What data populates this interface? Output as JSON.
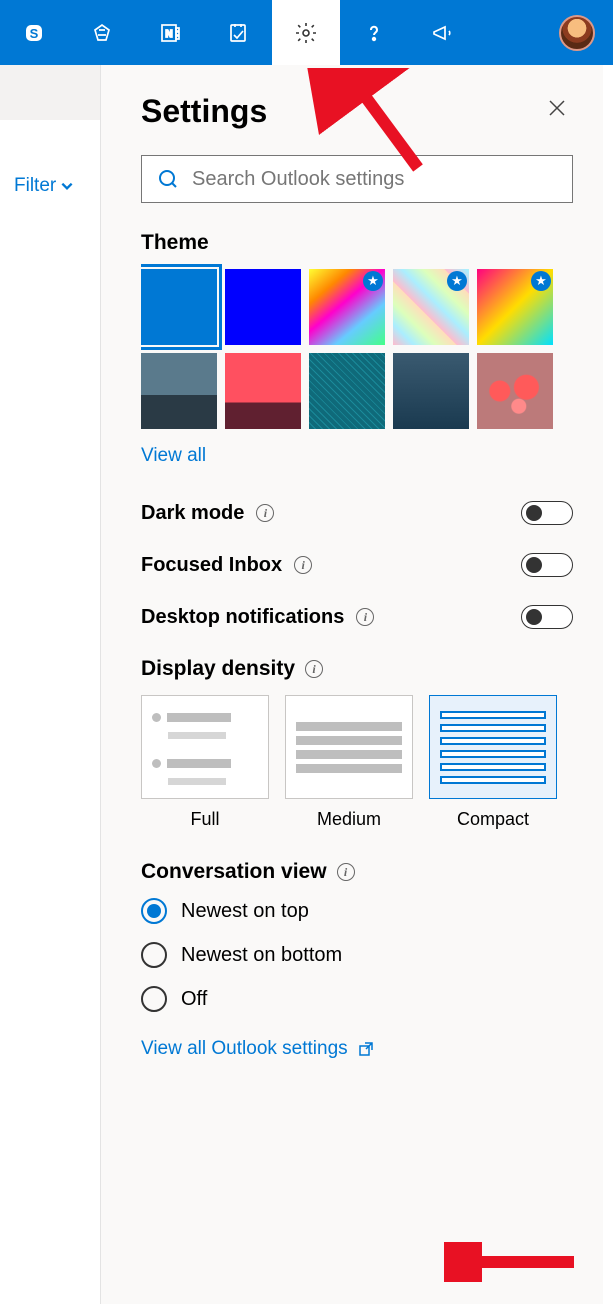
{
  "header": {
    "icons": [
      "skype-icon",
      "premium-icon",
      "onenote-icon",
      "todo-icon",
      "gear-icon",
      "help-icon",
      "megaphone-icon"
    ],
    "active_icon": "gear-icon"
  },
  "left": {
    "filter_label": "Filter"
  },
  "panel": {
    "title": "Settings",
    "search_placeholder": "Search Outlook settings",
    "theme": {
      "title": "Theme",
      "view_all": "View all",
      "tiles": [
        {
          "id": "blue",
          "starred": false,
          "selected": true
        },
        {
          "id": "darkblue",
          "starred": false,
          "selected": false
        },
        {
          "id": "rainbow",
          "starred": true,
          "selected": false
        },
        {
          "id": "prism",
          "starred": true,
          "selected": false
        },
        {
          "id": "art",
          "starred": true,
          "selected": false
        },
        {
          "id": "mountain",
          "starred": false,
          "selected": false
        },
        {
          "id": "sunset",
          "starred": false,
          "selected": false
        },
        {
          "id": "circuit",
          "starred": false,
          "selected": false
        },
        {
          "id": "elevation",
          "starred": false,
          "selected": false
        },
        {
          "id": "bokeh",
          "starred": false,
          "selected": false
        }
      ]
    },
    "toggles": {
      "dark_mode": {
        "label": "Dark mode",
        "on": false
      },
      "focused_inbox": {
        "label": "Focused Inbox",
        "on": false
      },
      "desktop_notifications": {
        "label": "Desktop notifications",
        "on": false
      }
    },
    "display_density": {
      "title": "Display density",
      "options": [
        "Full",
        "Medium",
        "Compact"
      ],
      "selected": "Compact"
    },
    "conversation_view": {
      "title": "Conversation view",
      "options": [
        "Newest on top",
        "Newest on bottom",
        "Off"
      ],
      "selected": "Newest on top"
    },
    "view_all_settings": "View all Outlook settings"
  }
}
